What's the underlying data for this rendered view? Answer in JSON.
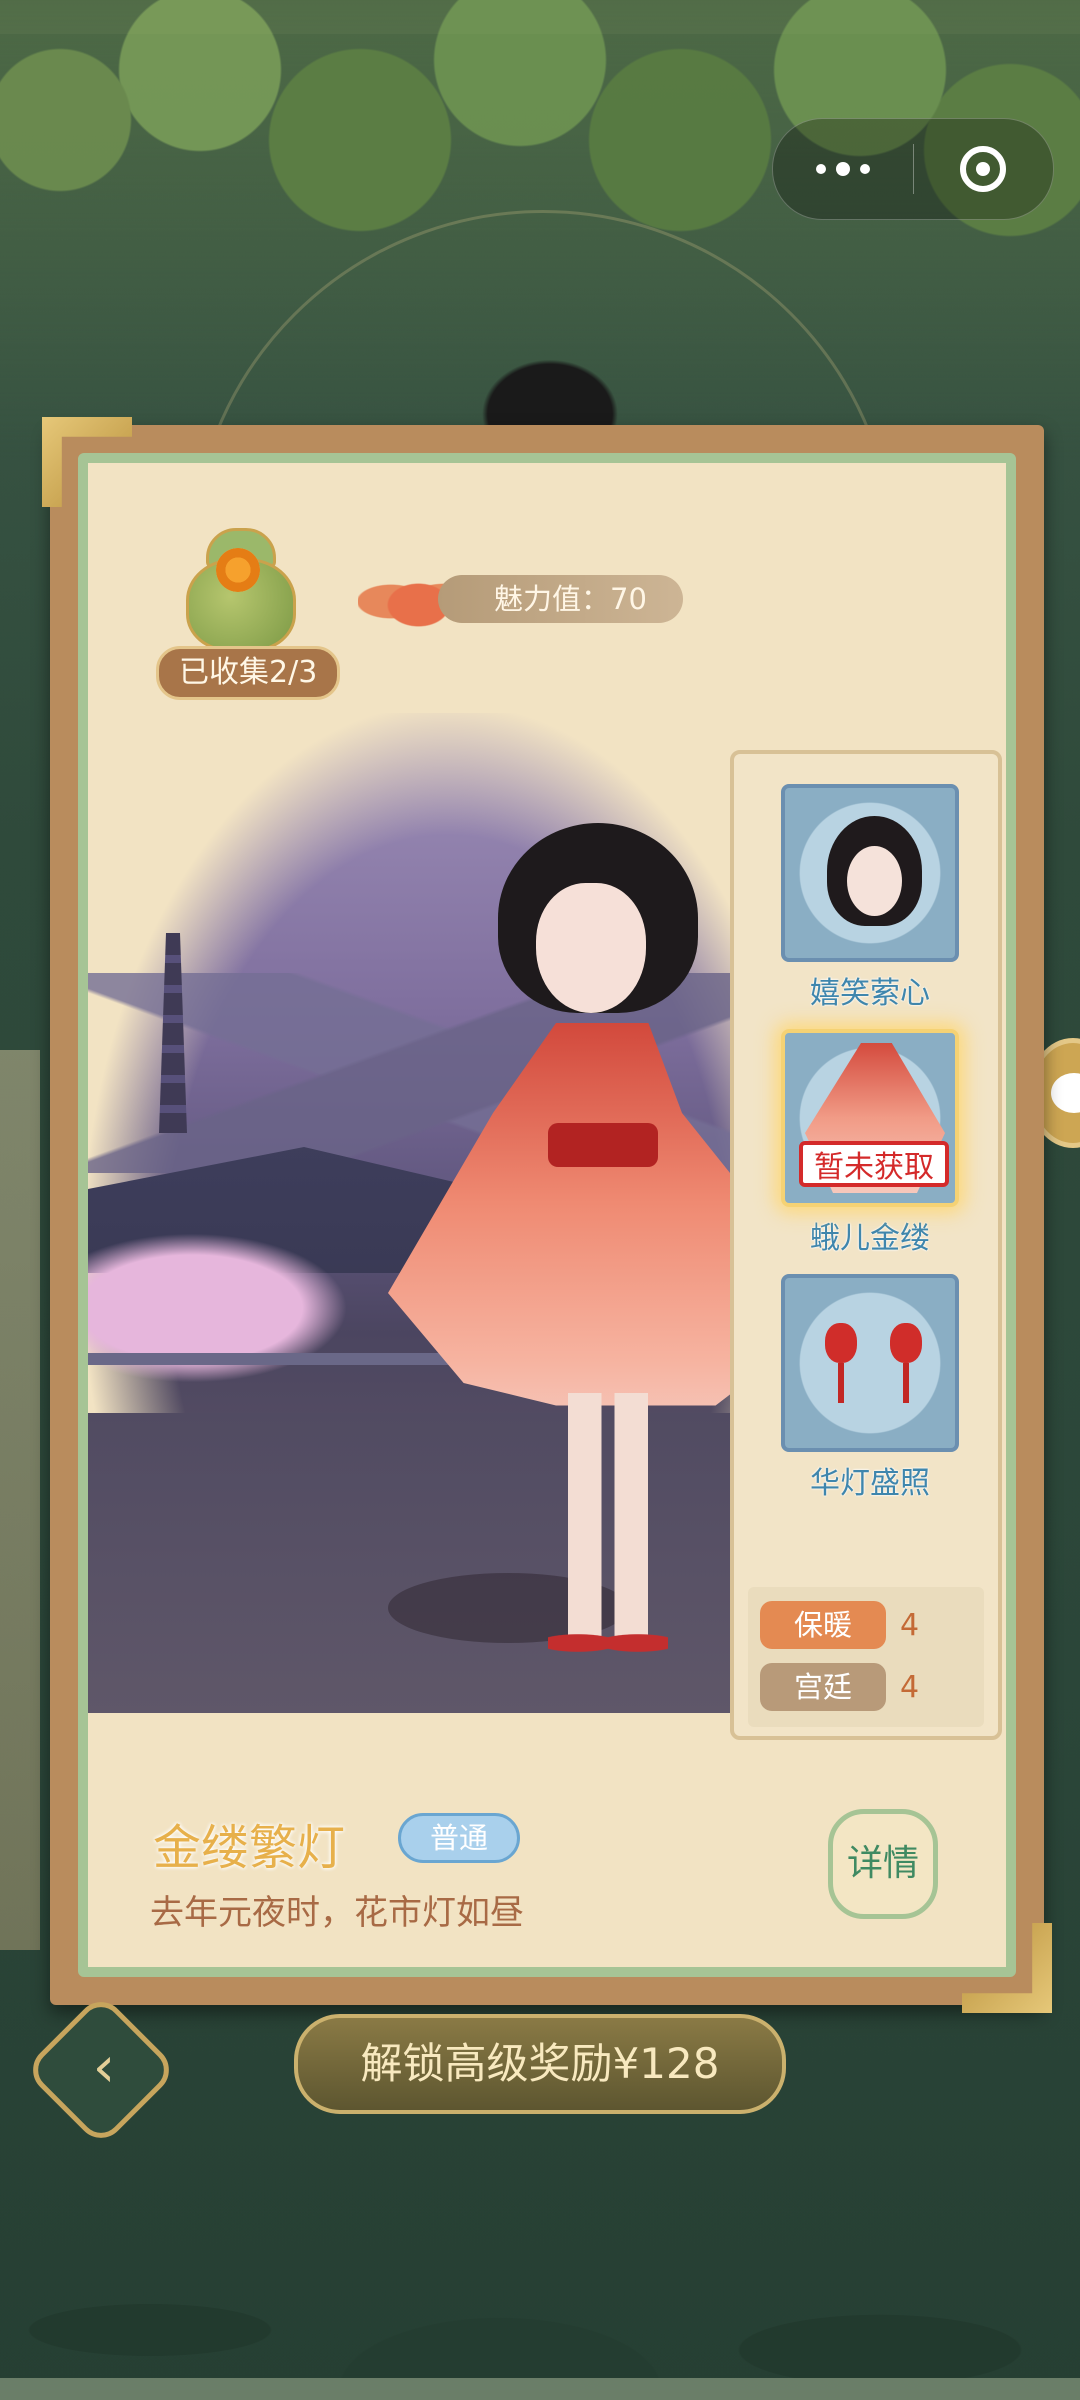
{
  "top_menu": {
    "more_icon": "more-dots-icon",
    "close_icon": "target-circle-icon"
  },
  "header": {
    "collected_label": "已收集2/3",
    "charm_label": "魅力值：",
    "charm_value": "70"
  },
  "items": [
    {
      "name": "嬉笑萦心",
      "icon": "hair-accessory-icon",
      "status": ""
    },
    {
      "name": "蛾儿金缕",
      "icon": "dress-icon",
      "status": "暂未获取"
    },
    {
      "name": "华灯盛照",
      "icon": "lantern-earrings-icon",
      "status": ""
    }
  ],
  "attributes": [
    {
      "label": "保暖",
      "value": "4",
      "color": "#e48a52"
    },
    {
      "label": "宫廷",
      "value": "4",
      "color": "#b89a79"
    }
  ],
  "outfit": {
    "name": "金缕繁灯",
    "rarity": "普通",
    "description": "去年元夜时，花市灯如昼"
  },
  "buttons": {
    "details": "详情",
    "unlock": "解锁高级奖励¥128",
    "back_icon": "back-arrow-icon"
  },
  "colors": {
    "accent_gold": "#e7b04b",
    "rarity_blue": "#a9d0ec",
    "not_obtained_red": "#d42a2a",
    "page_bg": "#f2e3c3"
  }
}
